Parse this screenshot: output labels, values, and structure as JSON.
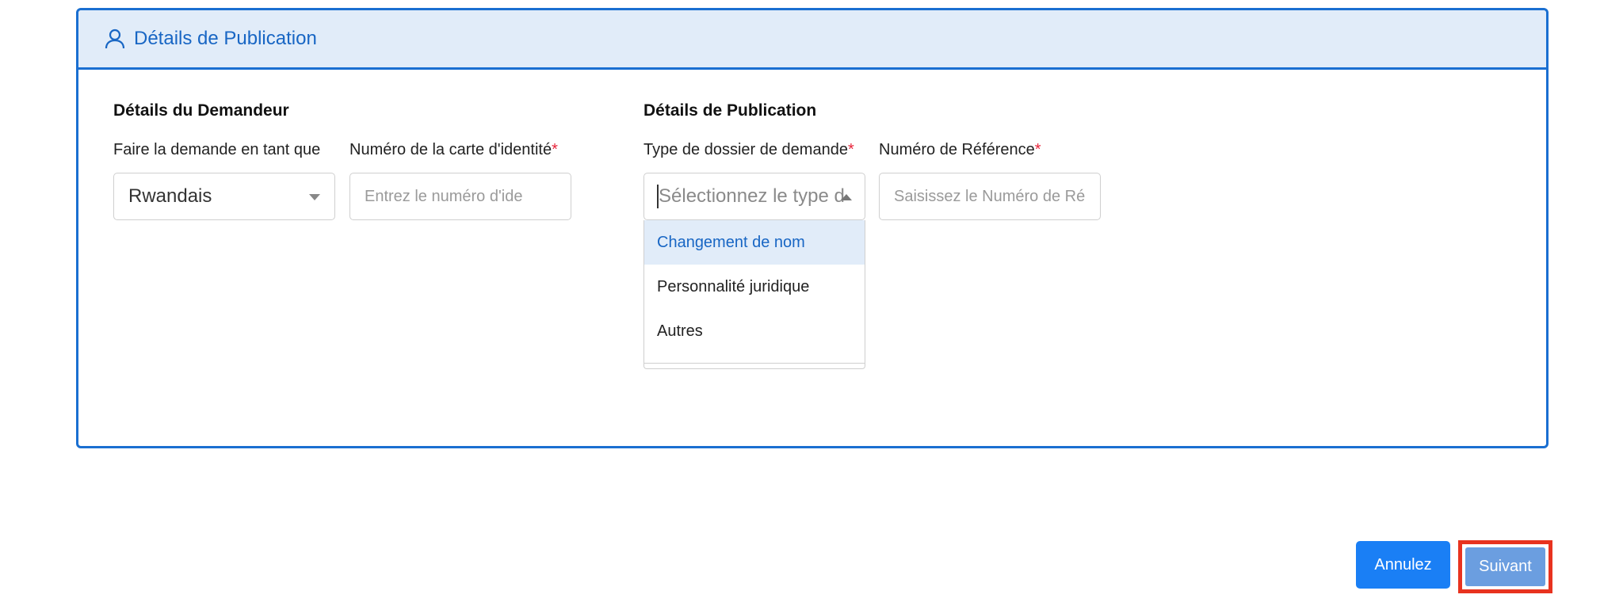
{
  "card": {
    "header_title": "Détails de Publication"
  },
  "applicant": {
    "section_title": "Détails du Demandeur",
    "apply_as_label": "Faire la demande en tant que",
    "apply_as_value": "Rwandais",
    "id_number_label": "Numéro de la carte d'identité",
    "id_number_placeholder": "Entrez le numéro d'ide"
  },
  "publication": {
    "section_title": "Détails de Publication",
    "file_type_label": "Type de dossier de demande",
    "file_type_placeholder": "Sélectionnez le type d",
    "file_type_options": [
      "Changement de nom",
      "Personnalité juridique",
      "Autres"
    ],
    "reference_label": "Numéro de Référence",
    "reference_placeholder": "Saisissez le Numéro de Ré"
  },
  "required_marker": "*",
  "actions": {
    "cancel_label": "Annulez",
    "next_label": "Suivant"
  },
  "colors": {
    "accent": "#1a6fd1",
    "header_bg": "#e1ecf9",
    "cancel_bg": "#1a7ff5",
    "next_bg": "#6b9ee0",
    "highlight": "#e8331f",
    "required": "#e8253b"
  }
}
